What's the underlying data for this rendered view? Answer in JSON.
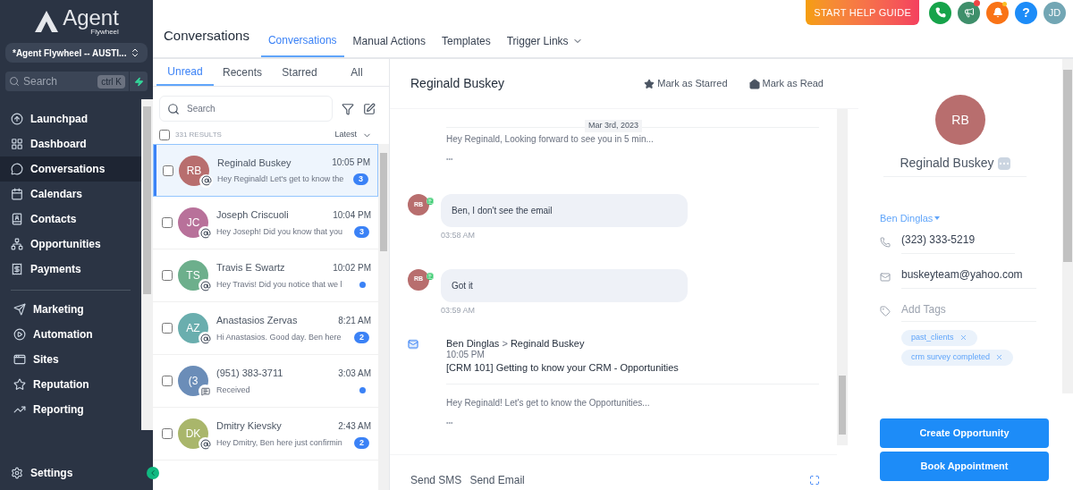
{
  "brand": {
    "name": "Agent",
    "sub": "Flywheel"
  },
  "account": {
    "label": "*Agent Flywheel -- AUSTI..."
  },
  "sidebar_search": {
    "placeholder": "Search",
    "shortcut": "ctrl K"
  },
  "sidebar": {
    "groups": [
      [
        {
          "label": "Launchpad",
          "selected": false
        },
        {
          "label": "Dashboard",
          "selected": false
        },
        {
          "label": "Conversations",
          "selected": true
        },
        {
          "label": "Calendars",
          "selected": false
        },
        {
          "label": "Contacts",
          "selected": false
        },
        {
          "label": "Opportunities",
          "selected": false
        },
        {
          "label": "Payments",
          "selected": false
        }
      ],
      [
        {
          "label": "Marketing",
          "selected": false
        },
        {
          "label": "Automation",
          "selected": false
        },
        {
          "label": "Sites",
          "selected": false
        },
        {
          "label": "Reputation",
          "selected": false
        },
        {
          "label": "Reporting",
          "selected": false
        }
      ]
    ],
    "settings": "Settings"
  },
  "topbar": {
    "help_guide": "START HELP GUIDE",
    "help": "?",
    "user_initials": "JD"
  },
  "page_title": "Conversations",
  "nav_tabs": [
    {
      "label": "Conversations",
      "selected": true,
      "dropdown": false
    },
    {
      "label": "Manual Actions",
      "selected": false,
      "dropdown": false
    },
    {
      "label": "Templates",
      "selected": false,
      "dropdown": false
    },
    {
      "label": "Trigger Links",
      "selected": false,
      "dropdown": true
    }
  ],
  "list_tabs": [
    {
      "label": "Unread",
      "selected": true
    },
    {
      "label": "Recents",
      "selected": false
    },
    {
      "label": "Starred",
      "selected": false
    },
    {
      "label": "All",
      "selected": false
    }
  ],
  "list_search": {
    "placeholder": "Search"
  },
  "select_all": {
    "checked": false
  },
  "results": "331 RESULTS",
  "sort": "Latest",
  "conversations": [
    {
      "initials": "RB",
      "color": "#b86e6e",
      "name": "Reginald Buskey",
      "time": "10:05 PM",
      "preview": "Hey Reginald! Let's get to know the",
      "kind": "email",
      "count": "3",
      "checked": false,
      "selected": true
    },
    {
      "initials": "JC",
      "color": "#b8719a",
      "name": "Joseph Criscuoli",
      "time": "10:04 PM",
      "preview": "Hey Joseph! Did you know that you",
      "kind": "email",
      "count": "3",
      "checked": false,
      "selected": false
    },
    {
      "initials": "TS",
      "color": "#6daf8c",
      "name": "Travis E Swartz",
      "time": "10:02 PM",
      "preview": "Hey Travis! Did you notice that we l",
      "kind": "email",
      "checked": false,
      "selected": false
    },
    {
      "initials": "AZ",
      "color": "#6aaeae",
      "name": "Anastasios Zervas",
      "time": "8:21 AM",
      "preview": "Hi Anastasios. Good day. Ben here",
      "kind": "email",
      "count": "2",
      "checked": false,
      "selected": false
    },
    {
      "initials": "(3",
      "color": "#6b8db8",
      "name": "(951) 383-3711",
      "time": "3:03 AM",
      "preview": "Received",
      "kind": "sms",
      "checked": false,
      "selected": false
    },
    {
      "initials": "DK",
      "color": "#a9b66b",
      "name": "Dmitry Kievsky",
      "time": "2:43 AM",
      "preview": "Hey Dmitry, Ben here just confirmin",
      "kind": "email",
      "count": "2",
      "checked": false,
      "selected": false
    }
  ],
  "chat": {
    "title": "Reginald Buskey",
    "actions": [
      "Mark as Starred",
      "Mark as Read"
    ],
    "messages": [
      {
        "kind": "email_snippet",
        "date": "Mar 3rd, 2023",
        "preview": "Hey Reginald, Looking forward to see you in 5 min...",
        "more": "•••"
      },
      {
        "kind": "sms",
        "initials": "RB",
        "text": "Ben, I don't see the email",
        "time": "03:58 AM"
      },
      {
        "kind": "sms",
        "initials": "RB",
        "text": "Got it",
        "time": "03:59 AM"
      },
      {
        "kind": "email",
        "from": "Ben Dinglas",
        "separator": ">",
        "to": "Reginald Buskey",
        "time": "10:05 PM",
        "subject": "[CRM 101] Getting to know your CRM - Opportunities",
        "preview": "Hey Reginald! Let's get to know the Opportunities...",
        "more": "•••"
      }
    ],
    "composer_tabs": [
      "Send SMS",
      "Send Email"
    ]
  },
  "contact": {
    "initials": "RB",
    "name": "Reginald Buskey",
    "owner": "Ben Dinglas",
    "phone": "(323) 333-5219",
    "email": "buskeyteam@yahoo.com",
    "tags_placeholder": "Add Tags",
    "tags": [
      "past_clients",
      "crm survey completed"
    ],
    "buttons": [
      "Create Opportunity",
      "Book Appointment"
    ]
  }
}
